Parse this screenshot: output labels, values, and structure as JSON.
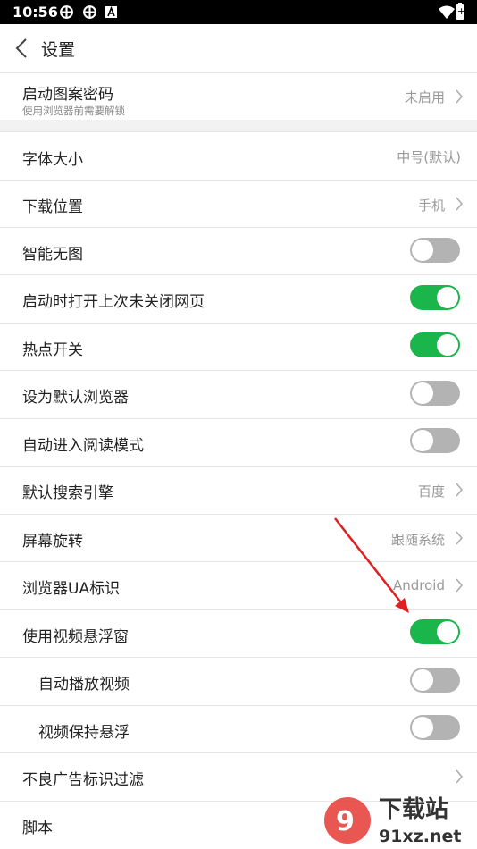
{
  "status_bar": {
    "time": "10:56",
    "battery_text": "+"
  },
  "header": {
    "title": "设置"
  },
  "pattern_row": {
    "label": "启动图案密码",
    "sub": "使用浏览器前需要解锁",
    "value": "未启用"
  },
  "rows": [
    {
      "label": "字体大小",
      "value": "中号(默认)"
    },
    {
      "label": "下载位置",
      "value": "手机"
    },
    {
      "label": "智能无图",
      "toggle": false
    },
    {
      "label": "启动时打开上次未关闭网页",
      "toggle": true
    },
    {
      "label": "热点开关",
      "toggle": true
    },
    {
      "label": "设为默认浏览器",
      "toggle": false
    },
    {
      "label": "自动进入阅读模式",
      "toggle": false
    },
    {
      "label": "默认搜索引擎",
      "value": "百度"
    },
    {
      "label": "屏幕旋转",
      "value": "跟随系统"
    },
    {
      "label": "浏览器UA标识",
      "value": "Android"
    },
    {
      "label": "使用视频悬浮窗",
      "toggle": true
    },
    {
      "label": "自动播放视频",
      "toggle": false
    },
    {
      "label": "视频保持悬浮",
      "toggle": false
    },
    {
      "label": "不良广告标识过滤"
    },
    {
      "label": "脚本"
    }
  ],
  "watermark": {
    "text1": "下载站",
    "text2": "91xz.net"
  },
  "colors": {
    "toggle_on": "#1ab54b",
    "toggle_off": "#b3b3b3",
    "annotation_arrow": "#e02020"
  },
  "icons": [
    "back-chevron-icon",
    "chevron-right-icon",
    "wifi-icon",
    "battery-icon",
    "notification-icon"
  ]
}
